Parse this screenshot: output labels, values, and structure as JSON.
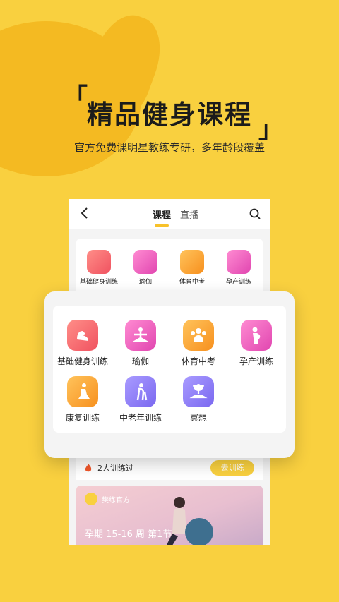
{
  "promo": {
    "headline": "精品健身课程",
    "subline": "官方免费课明星教练专研，多年龄段覆盖",
    "bracket_left": "「",
    "bracket_right": "」"
  },
  "nav": {
    "tab_courses": "课程",
    "tab_live": "直播"
  },
  "mini_categories": [
    {
      "label": "基础健身训练",
      "icon": "fitness-icon"
    },
    {
      "label": "瑜伽",
      "icon": "yoga-icon"
    },
    {
      "label": "体育中考",
      "icon": "sports-exam-icon"
    },
    {
      "label": "孕产训练",
      "icon": "pregnancy-icon"
    }
  ],
  "categories": [
    {
      "label": "基础健身训练",
      "icon": "fitness-icon"
    },
    {
      "label": "瑜伽",
      "icon": "yoga-icon"
    },
    {
      "label": "体育中考",
      "icon": "sports-exam-icon"
    },
    {
      "label": "孕产训练",
      "icon": "pregnancy-icon"
    },
    {
      "label": "康复训练",
      "icon": "rehab-icon"
    },
    {
      "label": "中老年训练",
      "icon": "senior-icon"
    },
    {
      "label": "冥想",
      "icon": "meditation-icon"
    }
  ],
  "trained": {
    "text": "2人训练过",
    "button": "去训练"
  },
  "video": {
    "brand": "樊练官方",
    "title": "孕期 15-16 周 第1节"
  },
  "colors": {
    "background": "#F9D03F",
    "accent": "#F8C22A"
  }
}
